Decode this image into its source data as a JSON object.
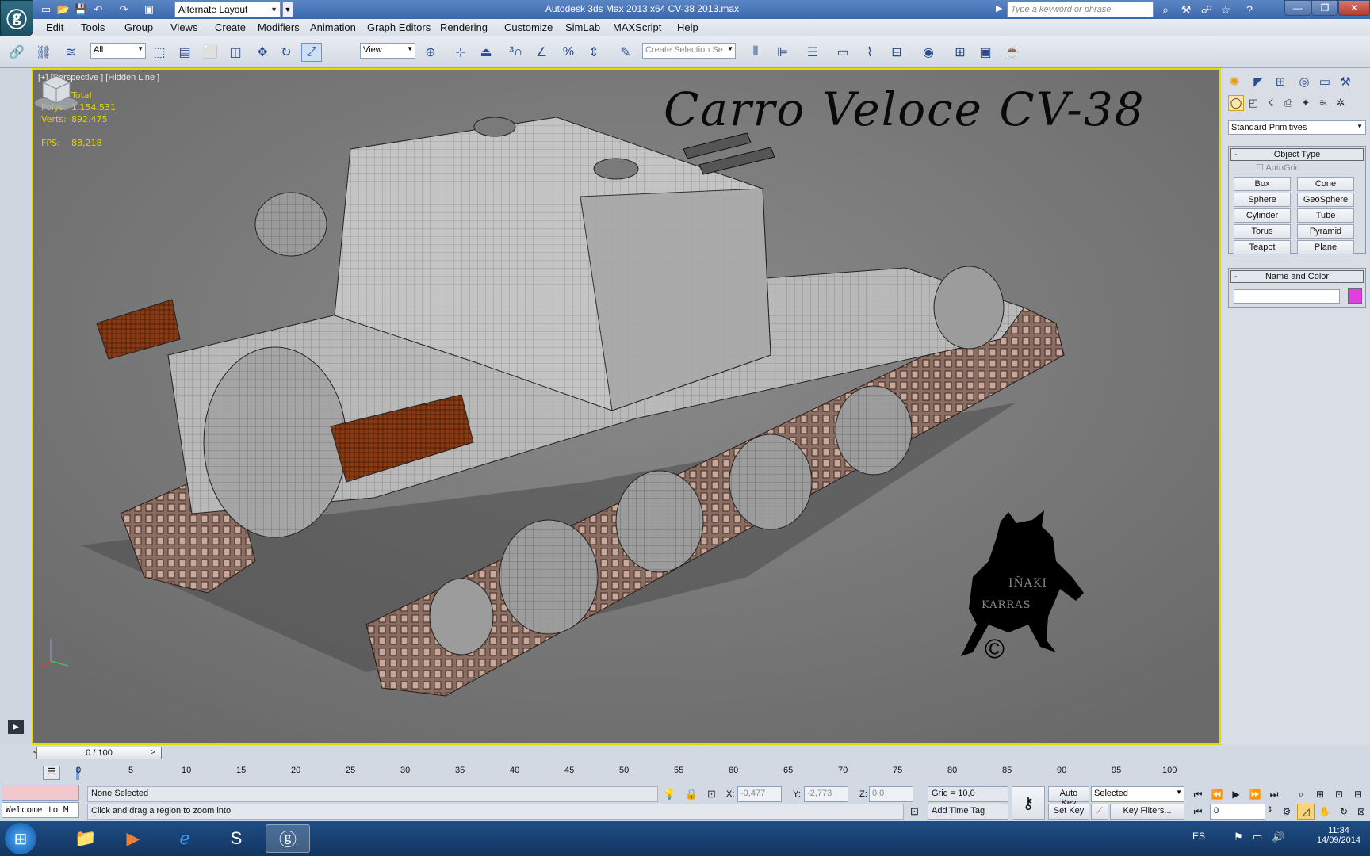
{
  "window": {
    "title": "Autodesk 3ds Max  2013 x64     CV-38 2013.max",
    "layout_name": "Alternate Layout",
    "search_placeholder": "Type a keyword or phrase"
  },
  "menu": [
    "Edit",
    "Tools",
    "Group",
    "Views",
    "Create",
    "Modifiers",
    "Animation",
    "Graph Editors",
    "Rendering",
    "Customize",
    "SimLab",
    "MAXScript",
    "Help"
  ],
  "toolbar": {
    "filter_value": "All",
    "ref_coord_value": "View",
    "named_selection_placeholder": "Create Selection Se"
  },
  "viewport": {
    "label": "[+] [Perspective ] [Hidden Line ]",
    "stats_header": "Total",
    "polys_label": "Polys:",
    "polys_value": "1.154.531",
    "verts_label": "Verts:",
    "verts_value": "892.475",
    "fps_label": "FPS:",
    "fps_value": "88,218",
    "scene_title": "Carro Veloce CV-38",
    "watermark_line1": "IÑAKI",
    "watermark_line2": "KARRAS",
    "watermark_symbol": "©"
  },
  "command_panel": {
    "category": "Standard Primitives",
    "object_type_title": "Object Type",
    "autogrid_label": "AutoGrid",
    "buttons": [
      "Box",
      "Cone",
      "Sphere",
      "GeoSphere",
      "Cylinder",
      "Tube",
      "Torus",
      "Pyramid",
      "Teapot",
      "Plane"
    ],
    "name_color_title": "Name and Color",
    "object_color": "#e040e0"
  },
  "timeline": {
    "slider_label": "0 / 100",
    "ticks": [
      "0",
      "5",
      "10",
      "15",
      "20",
      "25",
      "30",
      "35",
      "40",
      "45",
      "50",
      "55",
      "60",
      "65",
      "70",
      "75",
      "80",
      "85",
      "90",
      "95",
      "100"
    ]
  },
  "status": {
    "maxscript_listener": "Welcome to M",
    "selection": "None Selected",
    "prompt": "Click and drag a region to zoom into",
    "x_label": "X:",
    "x_value": "-0,477",
    "y_label": "Y:",
    "y_value": "-2,773",
    "z_label": "Z:",
    "z_value": "0,0",
    "grid": "Grid = 10,0",
    "add_time_tag": "Add Time Tag",
    "auto_key": "Auto Key",
    "set_key": "Set Key",
    "key_mode": "Selected",
    "key_filters": "Key Filters...",
    "frame_value": "0"
  },
  "taskbar": {
    "language": "ES",
    "time": "11:34",
    "date": "14/09/2014"
  },
  "colors": {
    "viewport_border": "#e6d900",
    "stats_text": "#e6d200",
    "title_bar": "#3b67ad"
  }
}
